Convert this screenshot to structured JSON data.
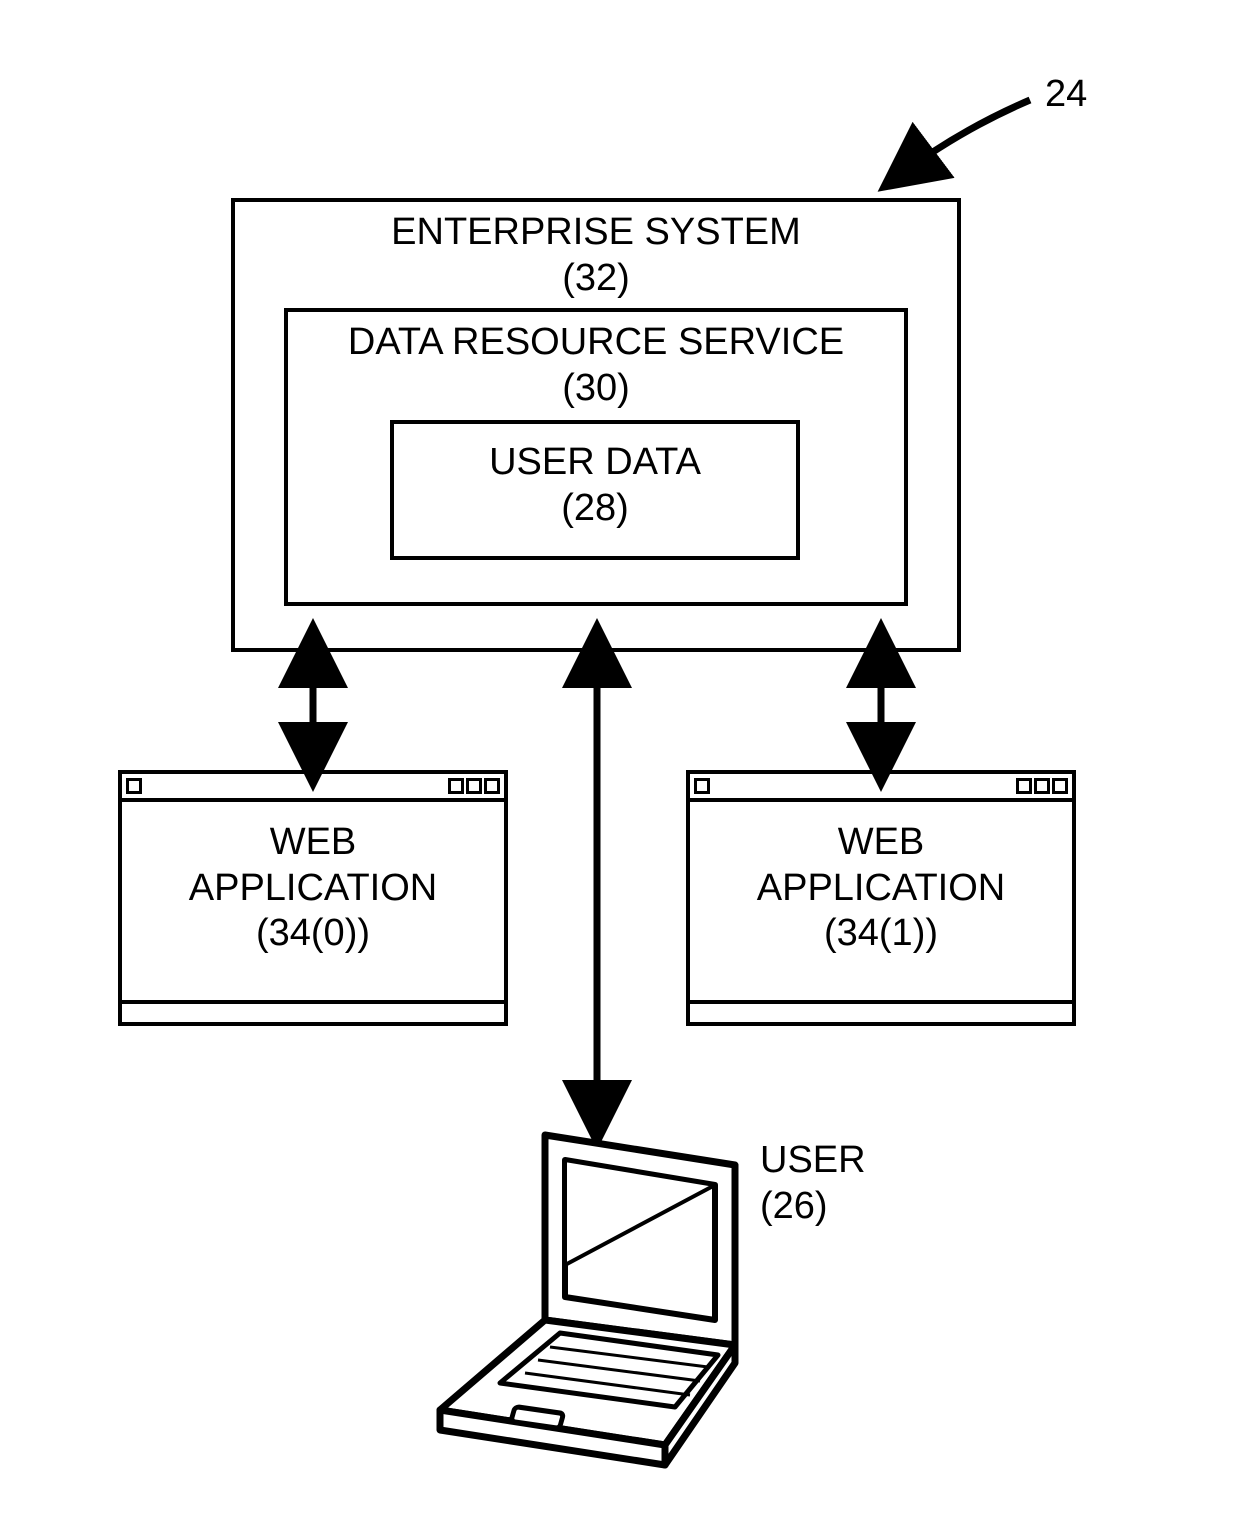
{
  "figure_ref": "24",
  "enterprise": {
    "title": "ENTERPRISE SYSTEM",
    "ref": "(32)"
  },
  "data_resource": {
    "title": "DATA RESOURCE SERVICE",
    "ref": "(30)"
  },
  "user_data": {
    "title": "USER DATA",
    "ref": "(28)"
  },
  "webapp0": {
    "title": "WEB\nAPPLICATION",
    "ref": "(34(0))"
  },
  "webapp1": {
    "title": "WEB\nAPPLICATION",
    "ref": "(34(1))"
  },
  "user": {
    "title": "USER",
    "ref": "(26)"
  }
}
